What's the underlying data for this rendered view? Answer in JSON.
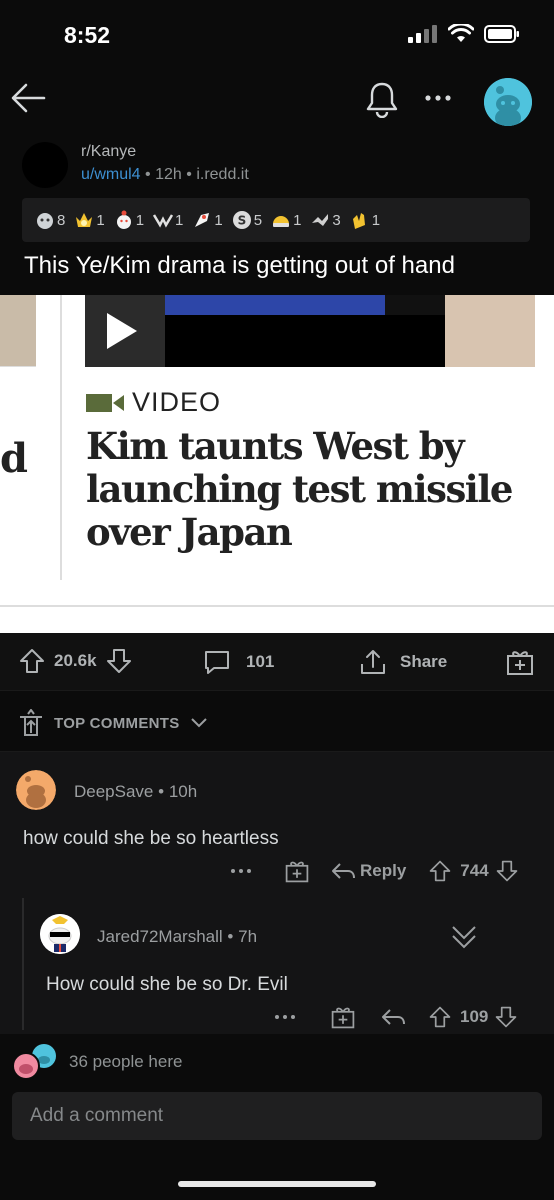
{
  "status_bar": {
    "time": "8:52"
  },
  "post": {
    "subreddit": "r/Kanye",
    "author": "u/wmul4",
    "age": "12h",
    "domain": "i.redd.it",
    "separator": "•",
    "title": "This Ye/Kim drama is getting out of hand",
    "awards": [
      {
        "icon": "silver-award-icon",
        "count": "8"
      },
      {
        "icon": "gold-award-icon",
        "count": "1"
      },
      {
        "icon": "wholesome-award-icon",
        "count": "1"
      },
      {
        "icon": "helpful-award-icon",
        "count": "1"
      },
      {
        "icon": "rocket-like-award-icon",
        "count": "1"
      },
      {
        "icon": "silver-coin-award-icon",
        "count": "5"
      },
      {
        "icon": "hugz-award-icon",
        "count": "1"
      },
      {
        "icon": "take-my-power-award-icon",
        "count": "3"
      },
      {
        "icon": "clapping-award-icon",
        "count": "1"
      }
    ],
    "image": {
      "video_label": "VIDEO",
      "headline": "Kim taunts West by launching test missile over Japan",
      "left_letter": "d"
    },
    "upvotes": "20.6k",
    "comments": "101",
    "share_label": "Share"
  },
  "sort": {
    "label": "TOP COMMENTS"
  },
  "comments": [
    {
      "author": "DeepSave",
      "age": "10h",
      "body": "how could she be so heartless",
      "reply_label": "Reply",
      "score": "744"
    },
    {
      "author": "Jared72Marshall",
      "age": "7h",
      "body": "How could she be so Dr. Evil",
      "score": "109"
    }
  ],
  "presence": {
    "text": "36 people here"
  },
  "composer": {
    "placeholder": "Add a comment"
  },
  "colors": {
    "background": "#0b0b0b",
    "username_link": "#3d8fd1",
    "avatar_teal": "#4fc3dd"
  }
}
